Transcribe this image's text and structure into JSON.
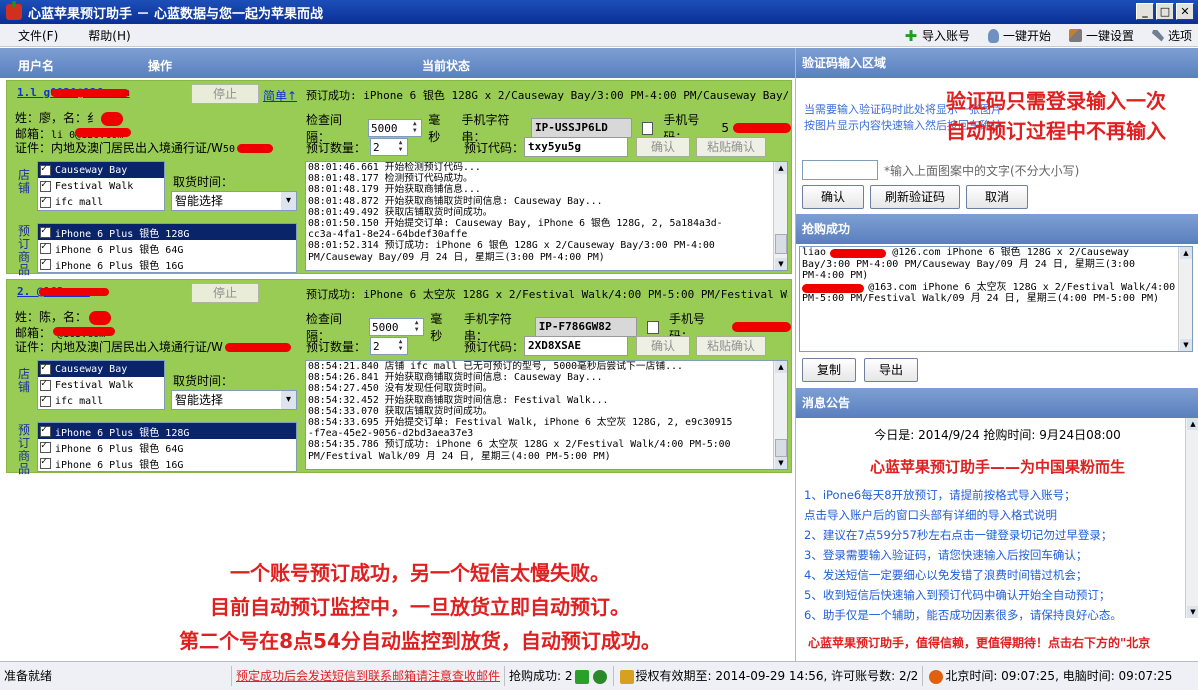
{
  "window": {
    "title": "心蓝苹果预订助手 － 心蓝数据与您一起为苹果而战"
  },
  "menu": {
    "file": "文件(F)",
    "help": "帮助(H)"
  },
  "toolbar": {
    "import": "导入账号",
    "start": "一键开始",
    "settings": "一键设置",
    "options": "选项"
  },
  "left_header": {
    "user": "用户名",
    "action": "操作",
    "status": "当前状态"
  },
  "labels": {
    "name_prefix": "姓：",
    "mail_prefix": "邮箱：",
    "id_prefix": "证件：内地及澳门居民出入境通行证/W",
    "interval": "检查间隔：",
    "ms": "毫秒",
    "phone_str": "手机字符串：",
    "phone_no": "手机号码：",
    "qty": "预订数量：",
    "code": "预订代码：",
    "confirm": "确认",
    "paste_confirm": "粘贴确认",
    "store_v": "店铺",
    "product_v": "预订商品",
    "pickup": "取货时间：",
    "stop": "停止"
  },
  "accounts": [
    {
      "email_visible": "1.l            g0920@126.com",
      "menu": "简单↑",
      "status": "预订成功: iPhone 6 银色 128G x 2/Causeway Bay/3:00 PM-4:00 PM/Causeway Bay/09 月",
      "name": "廖，名：纟",
      "mail": "li          0@126.com",
      "id_suffix": "50",
      "interval": "5000",
      "phone_str": "IP-USSJP6LD",
      "phone_no": "5",
      "qty": "2",
      "code": "txy5yu5g",
      "stores": [
        "Causeway Bay",
        "Festival Walk",
        "ifc mall"
      ],
      "pickup": "智能选择",
      "products": [
        "iPhone 6 Plus 银色 128G",
        "iPhone 6 Plus 银色 64G",
        "iPhone 6 Plus 银色 16G"
      ],
      "log": [
        "08:01:46.661 开始检测预订代码...",
        "08:01:48.177 检测预订代码成功。",
        "08:01:48.179 开始获取商铺信息...",
        "08:01:48.872 开始获取商铺取货时间信息: Causeway Bay...",
        "08:01:49.492 获取店铺取货时间成功。",
        "08:01:50.150 开始提交订单: Causeway Bay, iPhone 6 银色 128G, 2, 5a184a3d-",
        "cc3a-4fa1-8e24-64bdef30affe",
        "08:01:52.314 预订成功: iPhone 6 银色 128G x 2/Causeway Bay/3:00 PM-4:00",
        "PM/Causeway Bay/09 月 24 日, 星期三(3:00 PM-4:00 PM)"
      ]
    },
    {
      "email_visible": "2.              @163.com",
      "menu": "",
      "status": "预订成功: iPhone 6 太空灰 128G x 2/Festival Walk/4:00 PM-5:00 PM/Festival Walk/09",
      "name": "陈，名：",
      "mail": "              @163.com",
      "id_suffix": "",
      "interval": "5000",
      "phone_str": "IP-F786GW82",
      "phone_no": "",
      "qty": "2",
      "code": "2XD8XSAE",
      "stores": [
        "Causeway Bay",
        "Festival Walk",
        "ifc mall"
      ],
      "pickup": "智能选择",
      "products": [
        "iPhone 6 Plus 银色 128G",
        "iPhone 6 Plus 银色 64G",
        "iPhone 6 Plus 银色 16G"
      ],
      "log": [
        "08:54:21.840 店铺 ifc mall 已无可预订的型号, 5000毫秒后尝试下一店铺...",
        "08:54:26.841 开始获取商铺取货时间信息: Causeway Bay...",
        "08:54:27.450 没有发现任何取货时间。",
        "08:54:32.452 开始获取商铺取货时间信息: Festival Walk...",
        "08:54:33.070 获取店铺取货时间成功。",
        "08:54:33.695 开始提交订单: Festival Walk, iPhone 6 太空灰 128G, 2, e9c30915",
        "-f7ea-45e2-9056-d2bd3aea37e3",
        "08:54:35.786 预订成功: iPhone 6 太空灰 128G x 2/Festival Walk/4:00 PM-5:00",
        "PM/Festival Walk/09 月 24 日, 星期三(4:00 PM-5:00 PM)"
      ]
    }
  ],
  "commentary": [
    "一个账号预订成功，另一个短信太慢失败。",
    "目前自动预订监控中，一旦放货立即自动预订。",
    "第二个号在8点54分自动监控到放货，自动预订成功。"
  ],
  "captcha": {
    "header": "验证码输入区域",
    "hint1": "当需要输入验证码时此处将显示一张图片",
    "hint2": "按图片显示内容快速输入然后按回车确认",
    "overlay1": "验证码只需登录输入一次",
    "overlay2": "自动预订过程中不再输入",
    "input_hint": "*输入上面图案中的文字(不分大小写)",
    "confirm": "确认",
    "refresh": "刷新验证码",
    "cancel": "取消"
  },
  "success": {
    "header": "抢购成功",
    "lines": [
      "liao           @126.com iPhone 6 银色 128G x 2/Causeway",
      "Bay/3:00 PM-4:00 PM/Causeway Bay/09 月 24 日, 星期三(3:00",
      "PM-4:00 PM)",
      "           @163.com iPhone 6 太空灰 128G x 2/Festival Walk/4:00",
      "PM-5:00 PM/Festival Walk/09 月 24 日, 星期三(4:00 PM-5:00 PM)"
    ],
    "copy": "复制",
    "export": "导出"
  },
  "notice": {
    "header": "消息公告",
    "date": "今日是: 2014/9/24    抢购时间: 9月24日08:00",
    "slogan": "心蓝苹果预订助手——为中国果粉而生",
    "items": [
      "1、iPone6每天8开放预订，请提前按格式导入账号；",
      "    点击导入账户后的窗口头部有详细的导入格式说明",
      "2、建议在7点59分57秒左右点击一键登录切记勿过早登录；",
      "3、登录需要输入验证码，请您快速输入后按回车确认；",
      "4、发送短信一定要细心以免发错了浪费时间错过机会；",
      "5、收到短信后快速输入到预订代码中确认开始全自动预订；",
      "6、助手仅是一个辅助，能否成功因素很多，请保持良好心态。"
    ],
    "marquee": "心蓝苹果预订助手，值得信赖，更值得期待！点击右下方的\"北京"
  },
  "statusbar": {
    "ready": "准备就绪",
    "warning": "预定成功后会发送短信到联系邮箱请注意查收邮件",
    "success_count": "抢购成功: 2",
    "license": "授权有效期至: 2014-09-29 14:56, 许可账号数: 2/2",
    "beijing": "北京时间: 09:07:25, 电脑时间: 09:07:25"
  },
  "colors": {
    "panel_green": "#99cc55",
    "header_blue": "#5a7fbe",
    "alert_red": "#e02020",
    "link_blue": "#1133cc"
  }
}
